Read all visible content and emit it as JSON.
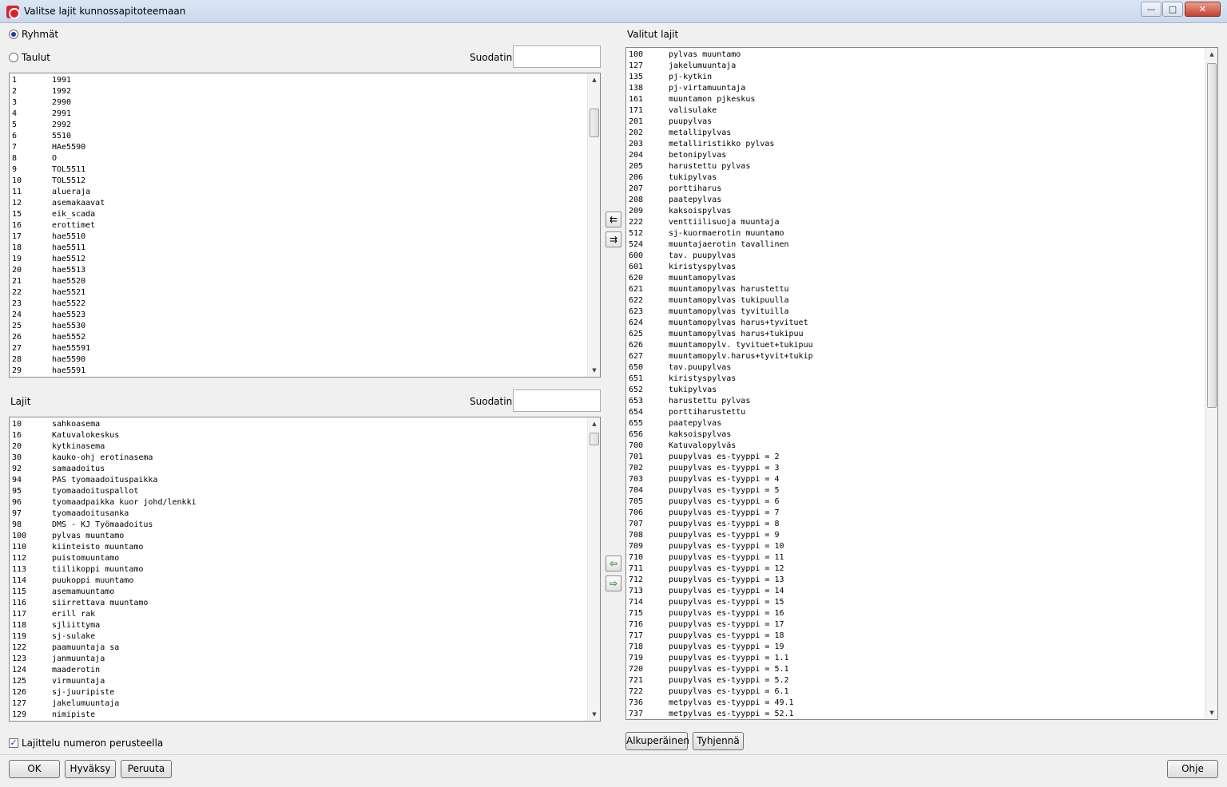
{
  "window": {
    "title": "Valitse lajit kunnossapitoteemaan",
    "minimize": "—",
    "maximize": "□",
    "close": "✕"
  },
  "left": {
    "radio_groups": "Ryhmät",
    "radio_tables": "Taulut",
    "filter_label": "Suodatin",
    "filter_value": "",
    "groups": [
      [
        "1",
        "1991"
      ],
      [
        "2",
        "1992"
      ],
      [
        "3",
        "2990"
      ],
      [
        "4",
        "2991"
      ],
      [
        "5",
        "2992"
      ],
      [
        "6",
        "5510"
      ],
      [
        "7",
        "HAe5590"
      ],
      [
        "8",
        "O"
      ],
      [
        "9",
        "TOL5511"
      ],
      [
        "10",
        "TOL5512"
      ],
      [
        "11",
        "alueraja"
      ],
      [
        "12",
        "asemakaavat"
      ],
      [
        "15",
        "eik_scada"
      ],
      [
        "16",
        "erottimet"
      ],
      [
        "17",
        "hae5510"
      ],
      [
        "18",
        "hae5511"
      ],
      [
        "19",
        "hae5512"
      ],
      [
        "20",
        "hae5513"
      ],
      [
        "21",
        "hae5520"
      ],
      [
        "22",
        "hae5521"
      ],
      [
        "23",
        "hae5522"
      ],
      [
        "24",
        "hae5523"
      ],
      [
        "25",
        "hae5530"
      ],
      [
        "26",
        "hae5552"
      ],
      [
        "27",
        "hae55591"
      ],
      [
        "28",
        "hae5590"
      ],
      [
        "29",
        "hae5591"
      ]
    ],
    "lajit_label": "Lajit",
    "lajit_filter_label": "Suodatin",
    "lajit_filter_value": "",
    "lajit": [
      [
        "10",
        "sahkoasema"
      ],
      [
        "16",
        "Katuvalokeskus"
      ],
      [
        "20",
        "kytkinasema"
      ],
      [
        "30",
        "kauko-ohj erotinasema"
      ],
      [
        "92",
        "samaadoitus"
      ],
      [
        "94",
        "PAS tyomaadoituspaikka"
      ],
      [
        "95",
        "tyomaadoituspallot"
      ],
      [
        "96",
        "tyomaadpaikka kuor johd/lenkki"
      ],
      [
        "97",
        "tyomaadoitusanka"
      ],
      [
        "98",
        "DMS - KJ Työmaadoitus"
      ],
      [
        "100",
        "pylvas muuntamo"
      ],
      [
        "110",
        "kiinteisto muuntamo"
      ],
      [
        "112",
        "puistomuuntamo"
      ],
      [
        "113",
        "tiilikoppi muuntamo"
      ],
      [
        "114",
        "puukoppi muuntamo"
      ],
      [
        "115",
        "asemamuuntamo"
      ],
      [
        "116",
        "siirrettava muuntamo"
      ],
      [
        "117",
        "erill rak"
      ],
      [
        "118",
        "sjliittyma"
      ],
      [
        "119",
        "sj-sulake"
      ],
      [
        "122",
        "paamuuntaja sa"
      ],
      [
        "123",
        "janmuuntaja"
      ],
      [
        "124",
        "maaderotin"
      ],
      [
        "125",
        "virmuuntaja"
      ],
      [
        "126",
        "sj-juuripiste"
      ],
      [
        "127",
        "jakelumuuntaja"
      ],
      [
        "129",
        "nimipiste"
      ]
    ],
    "sort_label": "Lajittelu numeron perusteella",
    "sort_checked": "✓"
  },
  "right": {
    "selected_label": "Valitut lajit",
    "selected": [
      [
        "100",
        "pylvas muuntamo"
      ],
      [
        "127",
        "jakelumuuntaja"
      ],
      [
        "135",
        "pj-kytkin"
      ],
      [
        "138",
        "pj-virtamuuntaja"
      ],
      [
        "161",
        "muuntamon pjkeskus"
      ],
      [
        "171",
        "valisulake"
      ],
      [
        "201",
        "puupylvas"
      ],
      [
        "202",
        "metallipylvas"
      ],
      [
        "203",
        "metalliristikko pylvas"
      ],
      [
        "204",
        "betonipylvas"
      ],
      [
        "205",
        "harustettu pylvas"
      ],
      [
        "206",
        "tukipylvas"
      ],
      [
        "207",
        "porttiharus"
      ],
      [
        "208",
        "paatepylvas"
      ],
      [
        "209",
        "kaksoispylvas"
      ],
      [
        "222",
        "venttiilisuoja muuntaja"
      ],
      [
        "512",
        "sj-kuormaerotin muuntamo"
      ],
      [
        "524",
        "muuntajaerotin tavallinen"
      ],
      [
        "600",
        "tav. puupylvas"
      ],
      [
        "601",
        "kiristyspylvas"
      ],
      [
        "620",
        "muuntamopylvas"
      ],
      [
        "621",
        "muuntamopylvas harustettu"
      ],
      [
        "622",
        "muuntamopylvas tukipuulla"
      ],
      [
        "623",
        "muuntamopylvas tyvituilla"
      ],
      [
        "624",
        "muuntamopylvas harus+tyvituet"
      ],
      [
        "625",
        "muuntamopylvas harus+tukipuu"
      ],
      [
        "626",
        "muuntamopylv. tyvituet+tukipuu"
      ],
      [
        "627",
        "muuntamopylv.harus+tyvit+tukip"
      ],
      [
        "650",
        "tav.puupylvas"
      ],
      [
        "651",
        "kiristyspylvas"
      ],
      [
        "652",
        "tukipylvas"
      ],
      [
        "653",
        "harustettu pylvas"
      ],
      [
        "654",
        "porttiharustettu"
      ],
      [
        "655",
        "paatepylvas"
      ],
      [
        "656",
        "kaksoispylvas"
      ],
      [
        "700",
        "Katuvalopylväs"
      ],
      [
        "701",
        "puupylvas es-tyyppi = 2"
      ],
      [
        "702",
        "puupylvas es-tyyppi = 3"
      ],
      [
        "703",
        "puupylvas es-tyyppi = 4"
      ],
      [
        "704",
        "puupylvas es-tyyppi = 5"
      ],
      [
        "705",
        "puupylvas es-tyyppi = 6"
      ],
      [
        "706",
        "puupylvas es-tyyppi = 7"
      ],
      [
        "707",
        "puupylvas es-tyyppi = 8"
      ],
      [
        "708",
        "puupylvas es-tyyppi = 9"
      ],
      [
        "709",
        "puupylvas es-tyyppi = 10"
      ],
      [
        "710",
        "puupylvas es-tyyppi = 11"
      ],
      [
        "711",
        "puupylvas es-tyyppi = 12"
      ],
      [
        "712",
        "puupylvas es-tyyppi = 13"
      ],
      [
        "713",
        "puupylvas es-tyyppi = 14"
      ],
      [
        "714",
        "puupylvas es-tyyppi = 15"
      ],
      [
        "715",
        "puupylvas es-tyyppi = 16"
      ],
      [
        "716",
        "puupylvas es-tyyppi = 17"
      ],
      [
        "717",
        "puupylvas es-tyyppi = 18"
      ],
      [
        "718",
        "puupylvas es-tyyppi = 19"
      ],
      [
        "719",
        "puupylvas es-tyyppi = 1.1"
      ],
      [
        "720",
        "puupylvas es-tyyppi = 5.1"
      ],
      [
        "721",
        "puupylvas es-tyyppi = 5.2"
      ],
      [
        "722",
        "puupylvas es-tyyppi = 6.1"
      ],
      [
        "736",
        "metpylvas es-tyyppi = 49.1"
      ],
      [
        "737",
        "metpylvas es-tyyppi = 52.1"
      ]
    ],
    "original_button": "Alkuperäinen",
    "clear_button": "Tyhjennä"
  },
  "buttons": {
    "ok": "OK",
    "apply": "Hyväksy",
    "cancel": "Peruuta",
    "help": "Ohje"
  },
  "transfer": {
    "add_all_groups": "⇇",
    "remove_groups": "⇉",
    "add_laji": "⇦",
    "remove_laji": "⇨"
  }
}
